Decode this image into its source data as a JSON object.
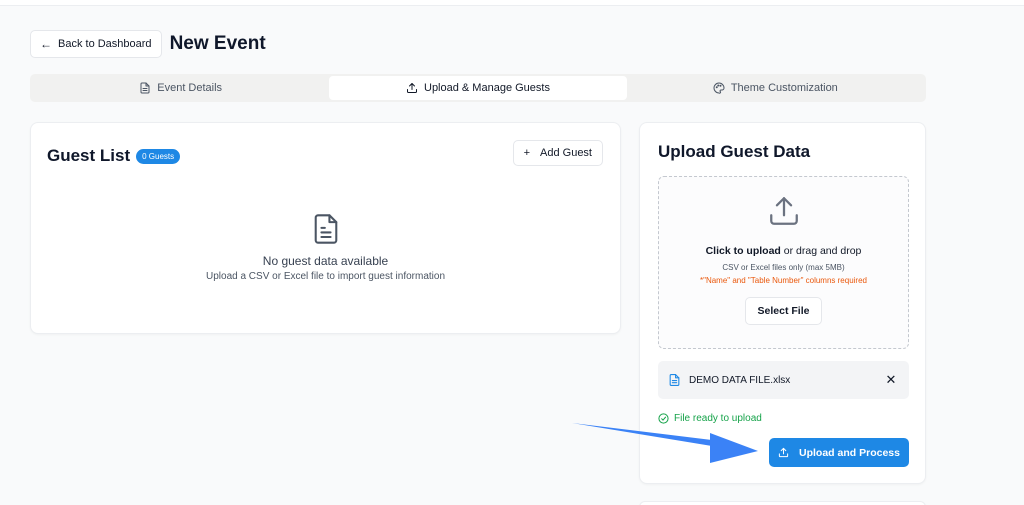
{
  "header": {
    "back_label": "Back to Dashboard",
    "back_icon": "arrow-left-icon",
    "title": "New Event"
  },
  "tabs": [
    {
      "label": "Event Details",
      "icon": "document-icon",
      "active": false
    },
    {
      "label": "Upload & Manage Guests",
      "icon": "upload-icon",
      "active": true
    },
    {
      "label": "Theme Customization",
      "icon": "palette-icon",
      "active": false
    }
  ],
  "guest_list": {
    "title": "Guest List",
    "count_badge": "0 Guests",
    "add_label": "Add Guest",
    "add_icon": "+",
    "empty_title": "No guest data available",
    "empty_subtitle": "Upload a CSV or Excel file to import guest information"
  },
  "upload": {
    "title": "Upload Guest Data",
    "click_text": "Click to upload",
    "drag_text": " or drag and drop",
    "file_types": "CSV or Excel files only (max 5MB)",
    "required_note": "*\"Name\" and \"Table Number\" columns required",
    "select_label": "Select File",
    "file_name": "DEMO DATA FILE.xlsx",
    "remove_icon": "✕",
    "ready_text": "File ready to upload",
    "process_label": "Upload and Process"
  },
  "colors": {
    "accent": "#1e88e5",
    "success": "#16a34a",
    "warning": "#ea580c",
    "annotation_arrow": "#3b82f6"
  }
}
